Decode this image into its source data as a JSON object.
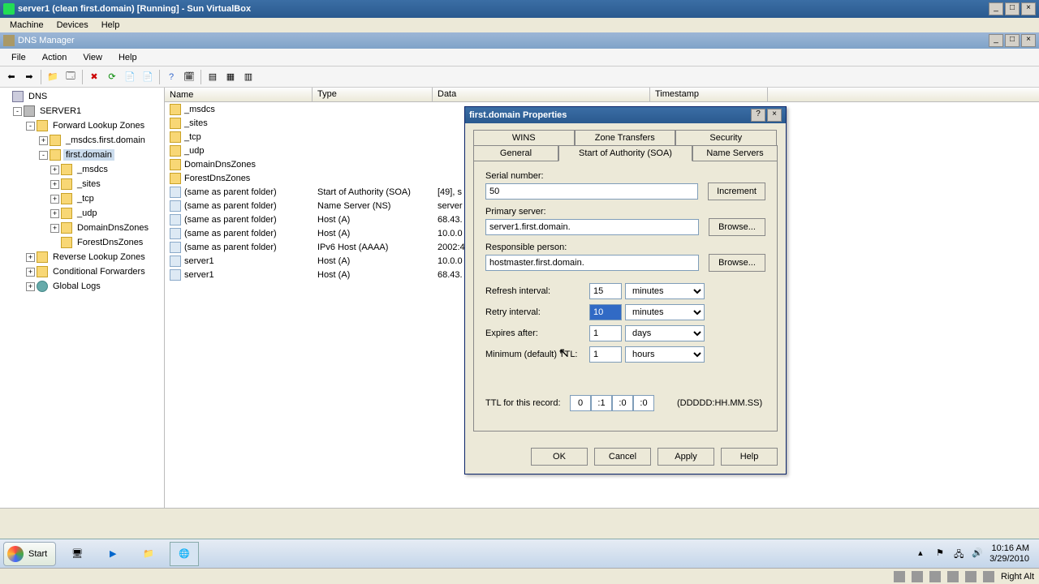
{
  "vbox": {
    "title": "server1 (clean first.domain) [Running] - Sun VirtualBox",
    "menus": [
      "Machine",
      "Devices",
      "Help"
    ],
    "status_right": "Right Alt"
  },
  "dns": {
    "title": "DNS Manager",
    "menus": [
      "File",
      "Action",
      "View",
      "Help"
    ],
    "tree": {
      "root": "DNS",
      "server": "SERVER1",
      "flz": "Forward Lookup Zones",
      "flz_children": [
        "_msdcs.first.domain",
        "first.domain"
      ],
      "firstdomain_children": [
        "_msdcs",
        "_sites",
        "_tcp",
        "_udp",
        "DomainDnsZones",
        "ForestDnsZones"
      ],
      "rlz": "Reverse Lookup Zones",
      "cf": "Conditional Forwarders",
      "gl": "Global Logs"
    },
    "columns": [
      "Name",
      "Type",
      "Data",
      "Timestamp"
    ],
    "rows": [
      {
        "name": "_msdcs",
        "type": "",
        "data": "",
        "icon": "folder"
      },
      {
        "name": "_sites",
        "type": "",
        "data": "",
        "icon": "folder"
      },
      {
        "name": "_tcp",
        "type": "",
        "data": "",
        "icon": "folder"
      },
      {
        "name": "_udp",
        "type": "",
        "data": "",
        "icon": "folder"
      },
      {
        "name": "DomainDnsZones",
        "type": "",
        "data": "",
        "icon": "folder"
      },
      {
        "name": "ForestDnsZones",
        "type": "",
        "data": "",
        "icon": "folder"
      },
      {
        "name": "(same as parent folder)",
        "type": "Start of Authority (SOA)",
        "data": "[49], s",
        "icon": "rec"
      },
      {
        "name": "(same as parent folder)",
        "type": "Name Server (NS)",
        "data": "server",
        "icon": "rec"
      },
      {
        "name": "(same as parent folder)",
        "type": "Host (A)",
        "data": "68.43.",
        "icon": "rec"
      },
      {
        "name": "(same as parent folder)",
        "type": "Host (A)",
        "data": "10.0.0",
        "icon": "rec"
      },
      {
        "name": "(same as parent folder)",
        "type": "IPv6 Host (AAAA)",
        "data": "2002:4",
        "icon": "rec"
      },
      {
        "name": "server1",
        "type": "Host (A)",
        "data": "10.0.0",
        "icon": "rec"
      },
      {
        "name": "server1",
        "type": "Host (A)",
        "data": "68.43.",
        "icon": "rec"
      }
    ]
  },
  "props": {
    "title": "first.domain Properties",
    "tabs_row1": [
      "WINS",
      "Zone Transfers",
      "Security"
    ],
    "tabs_row2": [
      "General",
      "Start of Authority (SOA)",
      "Name Servers"
    ],
    "labels": {
      "serial": "Serial number:",
      "primary": "Primary server:",
      "resp": "Responsible person:",
      "refresh": "Refresh interval:",
      "retry": "Retry interval:",
      "expires": "Expires after:",
      "minttl": "Minimum (default) TTL:",
      "ttlrec": "TTL for this record:",
      "ttlfmt": "(DDDDD:HH.MM.SS)"
    },
    "values": {
      "serial": "50",
      "primary": "server1.first.domain.",
      "resp": "hostmaster.first.domain.",
      "refresh_val": "15",
      "refresh_unit": "minutes",
      "retry_val": "10",
      "retry_unit": "minutes",
      "expires_val": "1",
      "expires_unit": "days",
      "minttl_val": "1",
      "minttl_unit": "hours",
      "ttl_d": "0",
      "ttl_h": ":1",
      "ttl_m": ":0",
      "ttl_s": ":0"
    },
    "buttons": {
      "increment": "Increment",
      "browse": "Browse...",
      "ok": "OK",
      "cancel": "Cancel",
      "apply": "Apply",
      "help": "Help"
    }
  },
  "taskbar": {
    "start": "Start",
    "time": "10:16 AM",
    "date": "3/29/2010"
  }
}
